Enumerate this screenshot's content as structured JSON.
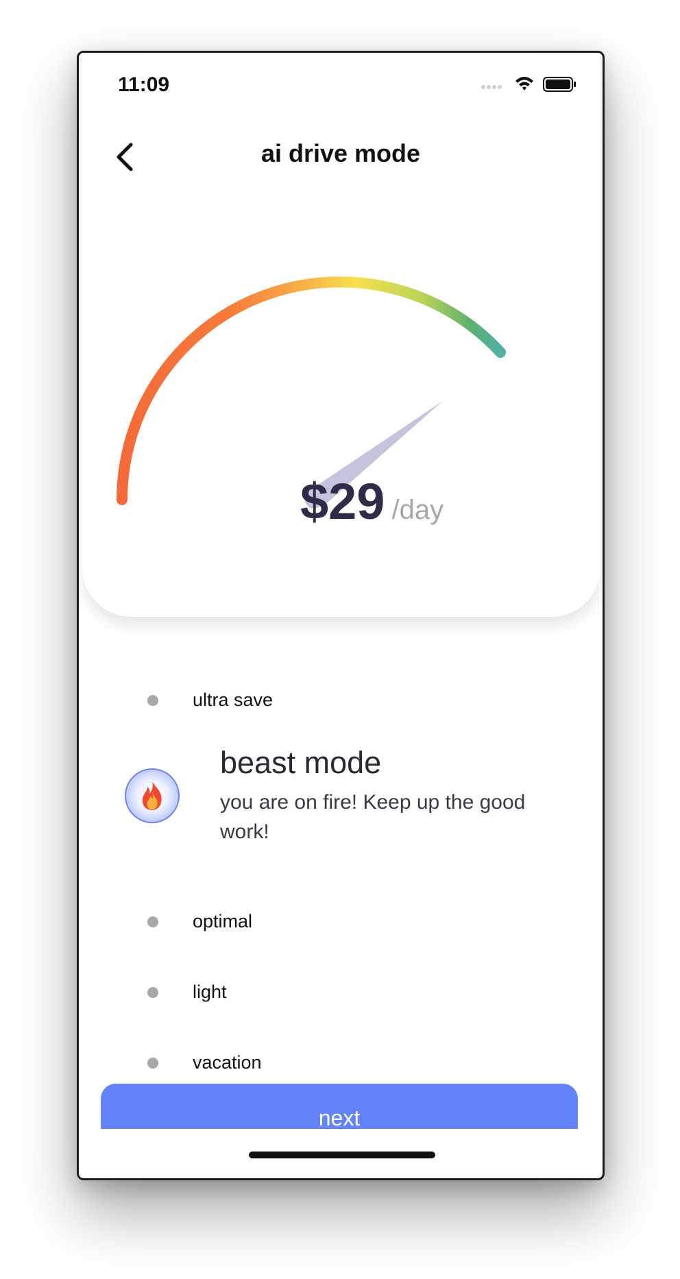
{
  "status_bar": {
    "time": "11:09",
    "icons": [
      "signal-dots-icon",
      "wifi-icon",
      "battery-icon"
    ]
  },
  "header": {
    "title": "ai drive mode",
    "back_icon": "chevron-left-icon"
  },
  "gauge": {
    "gradient_colors": [
      "#f56a38",
      "#f8a045",
      "#f6e04e",
      "#b6d256",
      "#5fb070",
      "#4fb0a6"
    ],
    "needle_color": "#c4c3dc",
    "price": "$29",
    "unit": "/day"
  },
  "modes": {
    "items": [
      {
        "label": "ultra save"
      },
      {
        "label": "optimal"
      },
      {
        "label": "light"
      },
      {
        "label": "vacation"
      }
    ],
    "active": {
      "title": "beast mode",
      "description": "you are on fire! Keep up the good work!",
      "icon": "fire-icon"
    }
  },
  "footer": {
    "next_label": "next"
  },
  "colors": {
    "accent": "#6283fa",
    "dot": "#a8a8a8",
    "dark_text": "#2f2c47"
  }
}
